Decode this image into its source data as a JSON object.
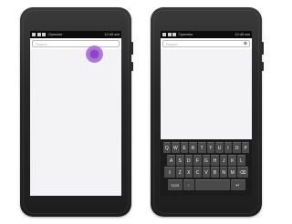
{
  "left_phone": {
    "status": {
      "operator": "Operator",
      "time": "12:45 am"
    },
    "search": {
      "placeholder": "Search",
      "value": ""
    }
  },
  "right_phone": {
    "status": {
      "operator": "Operator",
      "time": "12:45 am"
    },
    "search": {
      "placeholder": "Search",
      "value": "",
      "clear_glyph": "⊗"
    },
    "keyboard": {
      "rows": [
        [
          "Q",
          "W",
          "E",
          "R",
          "T",
          "Y",
          "U",
          "I",
          "O",
          "P"
        ],
        [
          "A",
          "S",
          "D",
          "F",
          "G",
          "H",
          "J",
          "K",
          "L"
        ],
        [
          "⇧",
          "Z",
          "X",
          "C",
          "V",
          "B",
          "N",
          "M",
          "⌫"
        ]
      ],
      "bottom": {
        "numbers": "?123",
        "left": "◦",
        "space": "",
        "enter": "↵"
      }
    }
  }
}
